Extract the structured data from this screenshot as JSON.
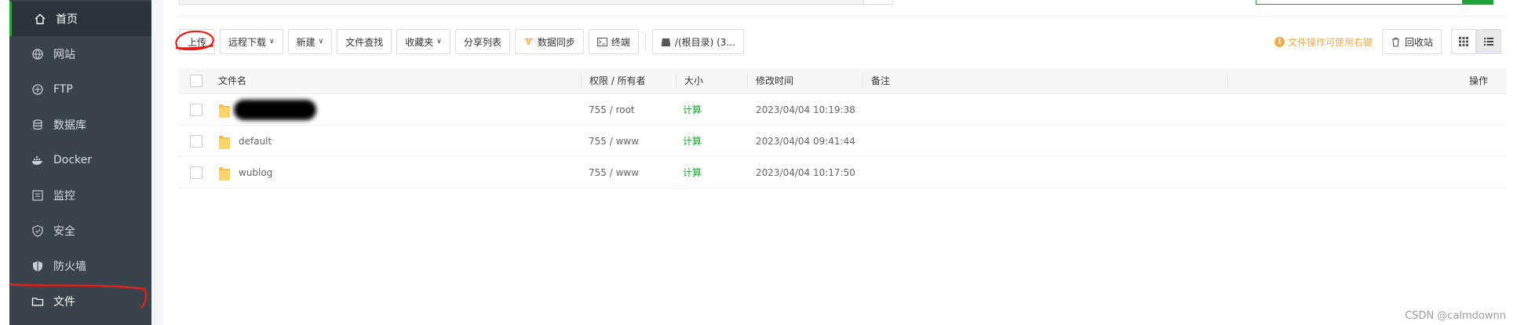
{
  "sidebar": {
    "items": [
      {
        "label": "首页",
        "icon": "home-icon",
        "active": true
      },
      {
        "label": "网站",
        "icon": "globe-icon"
      },
      {
        "label": "FTP",
        "icon": "ftp-icon"
      },
      {
        "label": "数据库",
        "icon": "database-icon"
      },
      {
        "label": "Docker",
        "icon": "docker-icon"
      },
      {
        "label": "监控",
        "icon": "monitor-icon"
      },
      {
        "label": "安全",
        "icon": "shield-icon"
      },
      {
        "label": "防火墙",
        "icon": "firewall-icon"
      },
      {
        "label": "文件",
        "icon": "folder-icon"
      }
    ]
  },
  "toolbar": {
    "upload": "上传",
    "remote_download": "远程下载",
    "new": "新建",
    "file_search": "文件查找",
    "favorites": "收藏夹",
    "share_list": "分享列表",
    "data_sync": "数据同步",
    "terminal": "终端",
    "root_dir": "/(根目录) (3..."
  },
  "right_tools": {
    "hint": "文件操作可使用右键",
    "recycle_bin": "回收站"
  },
  "table": {
    "headers": {
      "name": "文件名",
      "perm": "权限 / 所有者",
      "size": "大小",
      "mtime": "修改时间",
      "note": "备注",
      "actions": "操作"
    },
    "rows": [
      {
        "name": "",
        "perm": "755 / root",
        "size": "计算",
        "mtime": "2023/04/04 10:19:38",
        "redacted": true
      },
      {
        "name": "default",
        "perm": "755 / www",
        "size": "计算",
        "mtime": "2023/04/04 09:41:44"
      },
      {
        "name": "wublog",
        "perm": "755 / www",
        "size": "计算",
        "mtime": "2023/04/04 10:17:50"
      }
    ]
  },
  "watermark": "CSDN @calmdownn",
  "colors": {
    "sidebar_bg": "#39434c",
    "accent_green": "#20a53a",
    "hint_orange": "#f0ad4e",
    "annotation_red": "#e0201a"
  }
}
